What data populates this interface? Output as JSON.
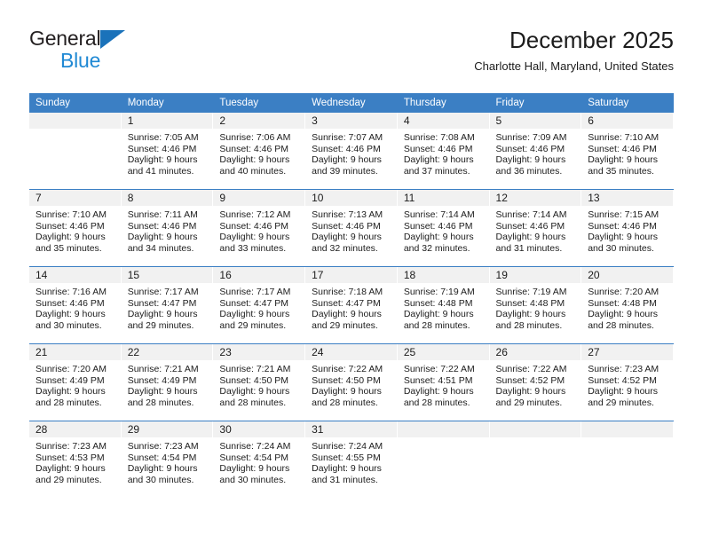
{
  "brand": {
    "name_dark": "General",
    "name_blue": "Blue",
    "triangle_color": "#1a72ba",
    "blue_color": "#2089d4"
  },
  "header": {
    "title": "December 2025",
    "subtitle": "Charlotte Hall, Maryland, United States"
  },
  "theme": {
    "header_blue": "#3b7fc4",
    "daynum_bg": "#f1f1f1",
    "text": "#1c1c1c"
  },
  "calendar": {
    "weekdays": [
      "Sunday",
      "Monday",
      "Tuesday",
      "Wednesday",
      "Thursday",
      "Friday",
      "Saturday"
    ],
    "weeks": [
      [
        {
          "day": "",
          "sunrise": "",
          "sunset": "",
          "daylight1": "",
          "daylight2": ""
        },
        {
          "day": "1",
          "sunrise": "Sunrise: 7:05 AM",
          "sunset": "Sunset: 4:46 PM",
          "daylight1": "Daylight: 9 hours",
          "daylight2": "and 41 minutes."
        },
        {
          "day": "2",
          "sunrise": "Sunrise: 7:06 AM",
          "sunset": "Sunset: 4:46 PM",
          "daylight1": "Daylight: 9 hours",
          "daylight2": "and 40 minutes."
        },
        {
          "day": "3",
          "sunrise": "Sunrise: 7:07 AM",
          "sunset": "Sunset: 4:46 PM",
          "daylight1": "Daylight: 9 hours",
          "daylight2": "and 39 minutes."
        },
        {
          "day": "4",
          "sunrise": "Sunrise: 7:08 AM",
          "sunset": "Sunset: 4:46 PM",
          "daylight1": "Daylight: 9 hours",
          "daylight2": "and 37 minutes."
        },
        {
          "day": "5",
          "sunrise": "Sunrise: 7:09 AM",
          "sunset": "Sunset: 4:46 PM",
          "daylight1": "Daylight: 9 hours",
          "daylight2": "and 36 minutes."
        },
        {
          "day": "6",
          "sunrise": "Sunrise: 7:10 AM",
          "sunset": "Sunset: 4:46 PM",
          "daylight1": "Daylight: 9 hours",
          "daylight2": "and 35 minutes."
        }
      ],
      [
        {
          "day": "7",
          "sunrise": "Sunrise: 7:10 AM",
          "sunset": "Sunset: 4:46 PM",
          "daylight1": "Daylight: 9 hours",
          "daylight2": "and 35 minutes."
        },
        {
          "day": "8",
          "sunrise": "Sunrise: 7:11 AM",
          "sunset": "Sunset: 4:46 PM",
          "daylight1": "Daylight: 9 hours",
          "daylight2": "and 34 minutes."
        },
        {
          "day": "9",
          "sunrise": "Sunrise: 7:12 AM",
          "sunset": "Sunset: 4:46 PM",
          "daylight1": "Daylight: 9 hours",
          "daylight2": "and 33 minutes."
        },
        {
          "day": "10",
          "sunrise": "Sunrise: 7:13 AM",
          "sunset": "Sunset: 4:46 PM",
          "daylight1": "Daylight: 9 hours",
          "daylight2": "and 32 minutes."
        },
        {
          "day": "11",
          "sunrise": "Sunrise: 7:14 AM",
          "sunset": "Sunset: 4:46 PM",
          "daylight1": "Daylight: 9 hours",
          "daylight2": "and 32 minutes."
        },
        {
          "day": "12",
          "sunrise": "Sunrise: 7:14 AM",
          "sunset": "Sunset: 4:46 PM",
          "daylight1": "Daylight: 9 hours",
          "daylight2": "and 31 minutes."
        },
        {
          "day": "13",
          "sunrise": "Sunrise: 7:15 AM",
          "sunset": "Sunset: 4:46 PM",
          "daylight1": "Daylight: 9 hours",
          "daylight2": "and 30 minutes."
        }
      ],
      [
        {
          "day": "14",
          "sunrise": "Sunrise: 7:16 AM",
          "sunset": "Sunset: 4:46 PM",
          "daylight1": "Daylight: 9 hours",
          "daylight2": "and 30 minutes."
        },
        {
          "day": "15",
          "sunrise": "Sunrise: 7:17 AM",
          "sunset": "Sunset: 4:47 PM",
          "daylight1": "Daylight: 9 hours",
          "daylight2": "and 29 minutes."
        },
        {
          "day": "16",
          "sunrise": "Sunrise: 7:17 AM",
          "sunset": "Sunset: 4:47 PM",
          "daylight1": "Daylight: 9 hours",
          "daylight2": "and 29 minutes."
        },
        {
          "day": "17",
          "sunrise": "Sunrise: 7:18 AM",
          "sunset": "Sunset: 4:47 PM",
          "daylight1": "Daylight: 9 hours",
          "daylight2": "and 29 minutes."
        },
        {
          "day": "18",
          "sunrise": "Sunrise: 7:19 AM",
          "sunset": "Sunset: 4:48 PM",
          "daylight1": "Daylight: 9 hours",
          "daylight2": "and 28 minutes."
        },
        {
          "day": "19",
          "sunrise": "Sunrise: 7:19 AM",
          "sunset": "Sunset: 4:48 PM",
          "daylight1": "Daylight: 9 hours",
          "daylight2": "and 28 minutes."
        },
        {
          "day": "20",
          "sunrise": "Sunrise: 7:20 AM",
          "sunset": "Sunset: 4:48 PM",
          "daylight1": "Daylight: 9 hours",
          "daylight2": "and 28 minutes."
        }
      ],
      [
        {
          "day": "21",
          "sunrise": "Sunrise: 7:20 AM",
          "sunset": "Sunset: 4:49 PM",
          "daylight1": "Daylight: 9 hours",
          "daylight2": "and 28 minutes."
        },
        {
          "day": "22",
          "sunrise": "Sunrise: 7:21 AM",
          "sunset": "Sunset: 4:49 PM",
          "daylight1": "Daylight: 9 hours",
          "daylight2": "and 28 minutes."
        },
        {
          "day": "23",
          "sunrise": "Sunrise: 7:21 AM",
          "sunset": "Sunset: 4:50 PM",
          "daylight1": "Daylight: 9 hours",
          "daylight2": "and 28 minutes."
        },
        {
          "day": "24",
          "sunrise": "Sunrise: 7:22 AM",
          "sunset": "Sunset: 4:50 PM",
          "daylight1": "Daylight: 9 hours",
          "daylight2": "and 28 minutes."
        },
        {
          "day": "25",
          "sunrise": "Sunrise: 7:22 AM",
          "sunset": "Sunset: 4:51 PM",
          "daylight1": "Daylight: 9 hours",
          "daylight2": "and 28 minutes."
        },
        {
          "day": "26",
          "sunrise": "Sunrise: 7:22 AM",
          "sunset": "Sunset: 4:52 PM",
          "daylight1": "Daylight: 9 hours",
          "daylight2": "and 29 minutes."
        },
        {
          "day": "27",
          "sunrise": "Sunrise: 7:23 AM",
          "sunset": "Sunset: 4:52 PM",
          "daylight1": "Daylight: 9 hours",
          "daylight2": "and 29 minutes."
        }
      ],
      [
        {
          "day": "28",
          "sunrise": "Sunrise: 7:23 AM",
          "sunset": "Sunset: 4:53 PM",
          "daylight1": "Daylight: 9 hours",
          "daylight2": "and 29 minutes."
        },
        {
          "day": "29",
          "sunrise": "Sunrise: 7:23 AM",
          "sunset": "Sunset: 4:54 PM",
          "daylight1": "Daylight: 9 hours",
          "daylight2": "and 30 minutes."
        },
        {
          "day": "30",
          "sunrise": "Sunrise: 7:24 AM",
          "sunset": "Sunset: 4:54 PM",
          "daylight1": "Daylight: 9 hours",
          "daylight2": "and 30 minutes."
        },
        {
          "day": "31",
          "sunrise": "Sunrise: 7:24 AM",
          "sunset": "Sunset: 4:55 PM",
          "daylight1": "Daylight: 9 hours",
          "daylight2": "and 31 minutes."
        },
        {
          "day": "",
          "sunrise": "",
          "sunset": "",
          "daylight1": "",
          "daylight2": ""
        },
        {
          "day": "",
          "sunrise": "",
          "sunset": "",
          "daylight1": "",
          "daylight2": ""
        },
        {
          "day": "",
          "sunrise": "",
          "sunset": "",
          "daylight1": "",
          "daylight2": ""
        }
      ]
    ]
  }
}
